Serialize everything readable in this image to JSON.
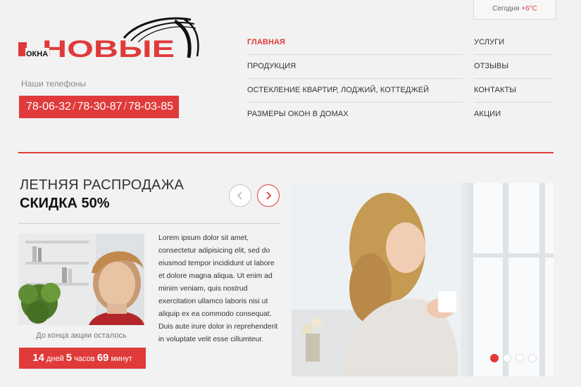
{
  "weather": {
    "label": "Сегодня",
    "temp": "+6°C"
  },
  "logo": {
    "big": "НОВЫЕ",
    "small": "ОКНА"
  },
  "phones": {
    "label": "Наши телефоны",
    "numbers": [
      "78-06-32",
      "78-30-87",
      "78-03-85"
    ]
  },
  "nav": {
    "left": [
      "ГЛАВНАЯ",
      "ПРОДУКЦИЯ",
      "ОСТЕКЛЕНИЕ КВАРТИР, ЛОДЖИЙ, КОТТЕДЖЕЙ",
      "РАЗМЕРЫ ОКОН В ДОМАХ"
    ],
    "right": [
      "УСЛУГИ",
      "ОТЗЫВЫ",
      "КОНТАКТЫ",
      "АКЦИИ"
    ],
    "active": "ГЛАВНАЯ"
  },
  "promo": {
    "title": "ЛЕТНЯЯ РАСПРОДАЖА",
    "subtitle": "СКИДКА 50%",
    "text": "Lorem ipsum dolor sit amet, consectetur adipisicing elit, sed do eiusmod tempor incididunt ut labore et dolore magna aliqua. Ut enim ad minim veniam, quis nostrud exercitation ullamco laboris nisi ut aliquip ex ea commodo consequat. Duis aute irure dolor in reprehenderit in voluptate velit esse cillumteur.",
    "countdown_label": "До конца акции осталось",
    "countdown": {
      "days": "14",
      "days_label": "дней",
      "hours": "5",
      "hours_label": "часов",
      "minutes": "69",
      "minutes_label": "минут"
    }
  },
  "slider": {
    "dots": 4,
    "active_index": 0
  },
  "colors": {
    "accent": "#e03a3a",
    "background": "#f2f2f2"
  }
}
